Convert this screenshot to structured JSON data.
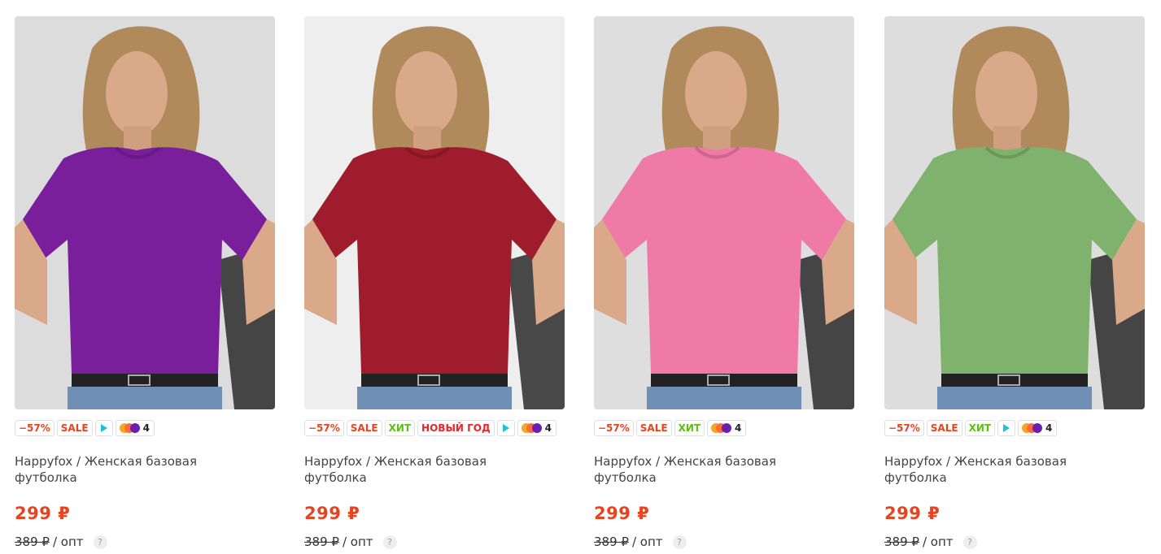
{
  "products": [
    {
      "discount": "−57%",
      "sale": "SALE",
      "hit": "",
      "new_year": "",
      "colors_count": "4",
      "title": "Happyfox / Женская базовая футболка",
      "price": "299 ₽",
      "old_price": "389 ₽",
      "old_suffix": "/ опт",
      "help": "?",
      "shirt_color": "#7a1f9b",
      "bg_color": "#dcdcdc"
    },
    {
      "discount": "−57%",
      "sale": "SALE",
      "hit": "ХИТ",
      "new_year": "НОВЫЙ ГОД",
      "colors_count": "4",
      "title": "Happyfox / Женская базовая футболка",
      "price": "299 ₽",
      "old_price": "389 ₽",
      "old_suffix": "/ опт",
      "help": "?",
      "shirt_color": "#9e1c2c",
      "bg_color": "#eeeeee"
    },
    {
      "discount": "−57%",
      "sale": "SALE",
      "hit": "ХИТ",
      "new_year": "",
      "colors_count": "4",
      "title": "Happyfox / Женская базовая футболка",
      "price": "299 ₽",
      "old_price": "389 ₽",
      "old_suffix": "/ опт",
      "help": "?",
      "shirt_color": "#f07aa6",
      "bg_color": "#dedede"
    },
    {
      "discount": "−57%",
      "sale": "SALE",
      "hit": "ХИТ",
      "new_year": "",
      "colors_count": "4",
      "title": "Happyfox / Женская базовая футболка",
      "price": "299 ₽",
      "old_price": "389 ₽",
      "old_suffix": "/ опт",
      "help": "?",
      "shirt_color": "#7fb36d",
      "bg_color": "#dddddd"
    }
  ],
  "colors": {
    "accent": "#e8431f",
    "hit": "#5bbf14",
    "play": "#1ec2d8",
    "swatch_orange": "#f5a623",
    "swatch_purple": "#6a1fb0"
  }
}
